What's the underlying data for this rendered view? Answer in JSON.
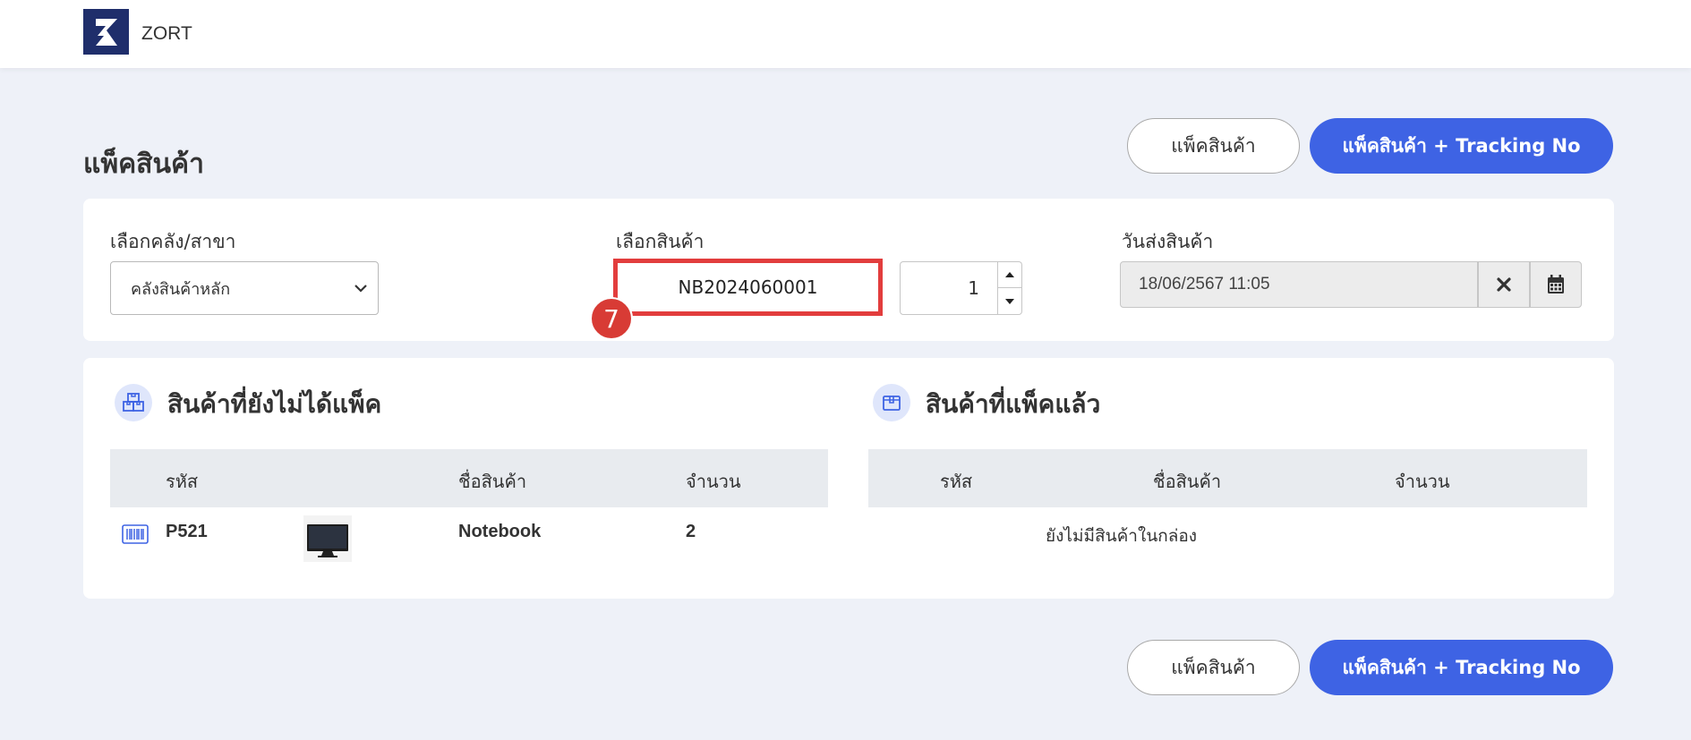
{
  "header": {
    "brand": "ZORT",
    "logo_icon": "zort-logo"
  },
  "page": {
    "title": "แพ็คสินค้า"
  },
  "actions": {
    "pack_label": "แพ็คสินค้า",
    "pack_tracking_label": "แพ็คสินค้า + Tracking No"
  },
  "filters": {
    "warehouse_label": "เลือกคลัง/สาขา",
    "warehouse_value": "คลังสินค้าหลัก",
    "product_label": "เลือกสินค้า",
    "product_value": "NB2024060001",
    "quantity_value": "1",
    "ship_date_label": "วันส่งสินค้า",
    "ship_date_value": "18/06/2567 11:05",
    "step_badge": "7"
  },
  "unpacked": {
    "title": "สินค้าที่ยังไม่ได้แพ็ค",
    "columns": [
      "รหัส",
      "ชื่อสินค้า",
      "จำนวน"
    ],
    "rows": [
      {
        "code": "P521",
        "name": "Notebook",
        "qty": "2"
      }
    ]
  },
  "packed": {
    "title": "สินค้าที่แพ็คแล้ว",
    "columns": [
      "รหัส",
      "ชื่อสินค้า",
      "จำนวน"
    ],
    "empty_message": "ยังไม่มีสินค้าในกล่อง"
  },
  "colors": {
    "primary": "#3e63e4",
    "highlight": "#e23d3d",
    "background": "#eef1f8"
  }
}
